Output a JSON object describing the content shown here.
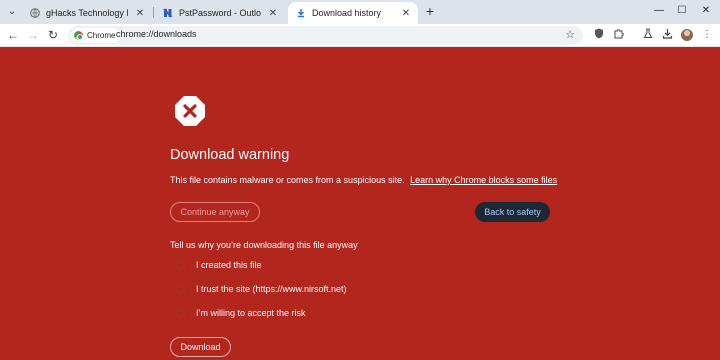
{
  "browser": {
    "tabs": [
      {
        "title": "gHacks Technology News and A",
        "favicon": "ghacks-favicon",
        "active": false
      },
      {
        "title": "PstPassword - Outlook PST Pas",
        "favicon": "nirsoft-favicon",
        "active": false
      },
      {
        "title": "Download history",
        "favicon": "download-icon",
        "active": true
      }
    ],
    "address_chip": "Chrome",
    "url": "chrome://downloads"
  },
  "page": {
    "heading": "Download warning",
    "description": "This file contains malware or comes from a suspicious site.",
    "learn_link": "Learn why Chrome blocks some files",
    "continue_label": "Continue anyway",
    "back_label": "Back to safety",
    "reason_title": "Tell us why you’re downloading this file anyway",
    "options": [
      "I created this file",
      "I trust the site (https://www.nirsoft.net)",
      "I’m willing to accept the risk"
    ],
    "download_label": "Download"
  },
  "colors": {
    "page_background": "#b3261e",
    "primary_button": "#1e2a33",
    "primary_button_text": "#a8c7fa"
  }
}
